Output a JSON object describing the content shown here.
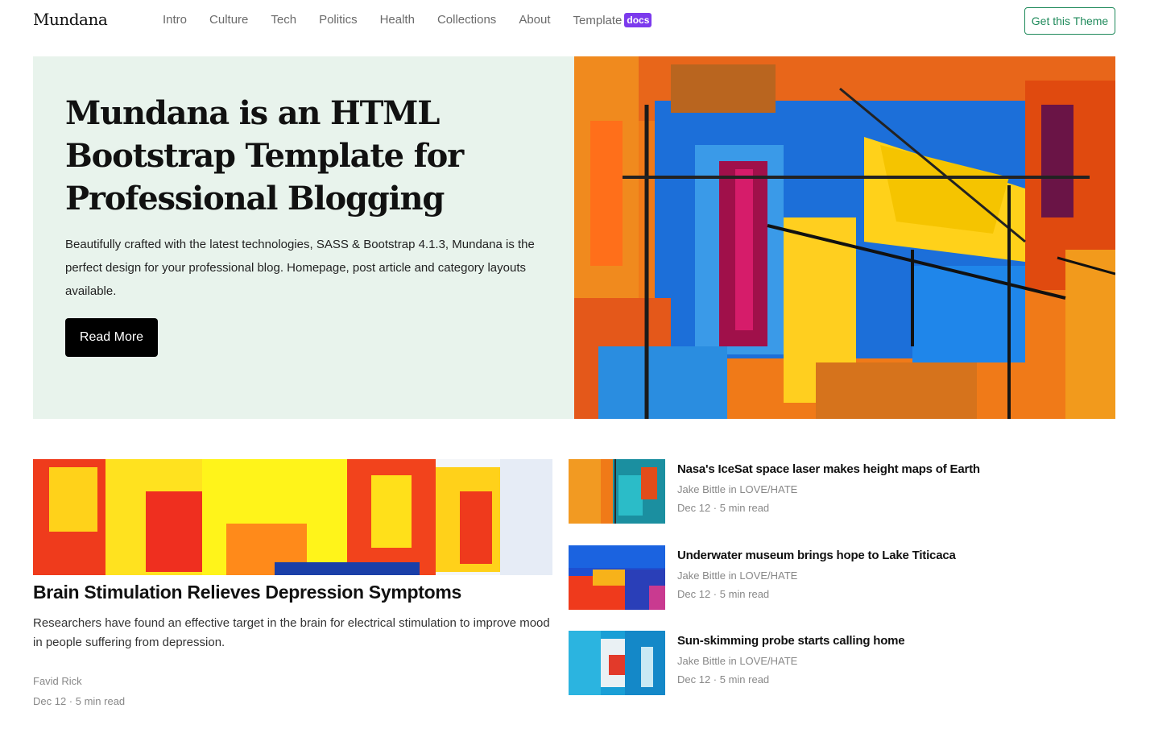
{
  "nav": {
    "brand": "Mundana",
    "links": [
      "Intro",
      "Culture",
      "Tech",
      "Politics",
      "Health",
      "Collections",
      "About"
    ],
    "template_label": "Template",
    "docs_badge": "docs",
    "cta": "Get this Theme"
  },
  "hero": {
    "title": "Mundana is an HTML Bootstrap Template for Professional Blogging",
    "description": "Beautifully crafted with the latest technologies, SASS & Bootstrap 4.1.3, Mundana is the perfect design for your professional blog. Homepage, post article and category layouts available.",
    "button": "Read More"
  },
  "featured": {
    "title": "Brain Stimulation Relieves Depression Symptoms",
    "description": "Researchers have found an effective target in the brain for electrical stimulation to improve mood in people suffering from depression.",
    "author": "Favid Rick",
    "meta": "Dec 12 · 5 min read"
  },
  "side_posts": [
    {
      "title": "Nasa's IceSat space laser makes height maps of Earth",
      "author": "Jake Bittle in LOVE/HATE",
      "meta": "Dec 12 · 5 min read"
    },
    {
      "title": "Underwater museum brings hope to Lake Titicaca",
      "author": "Jake Bittle in LOVE/HATE",
      "meta": "Dec 12 · 5 min read"
    },
    {
      "title": "Sun-skimming probe starts calling home",
      "author": "Jake Bittle in LOVE/HATE",
      "meta": "Dec 12 · 5 min read"
    }
  ],
  "colors": {
    "hero_bg": "#e8f3ec",
    "accent": "#1f8a5b",
    "docs_badge": "#7c3aed"
  }
}
